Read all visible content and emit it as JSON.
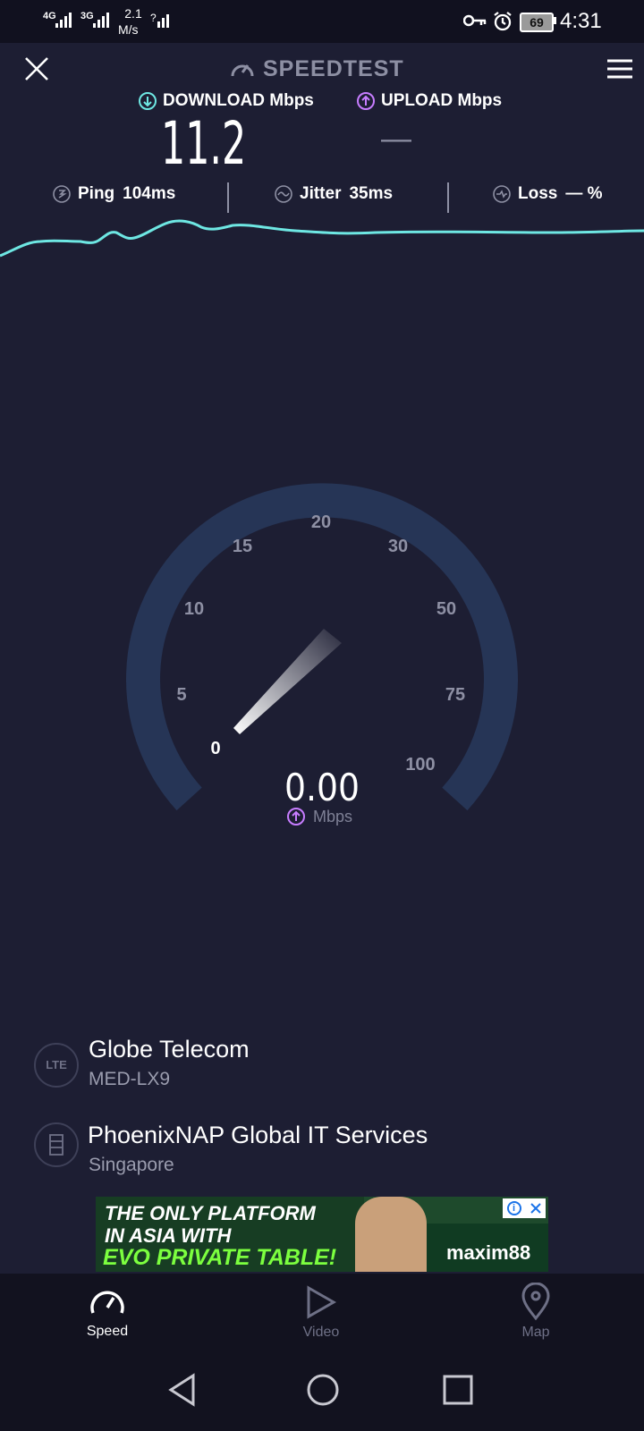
{
  "status_bar": {
    "net1": "4G",
    "net2": "3G",
    "speed_value": "2.1",
    "speed_unit": "M/s",
    "battery": "69",
    "time": "4:31"
  },
  "header": {
    "title": "SPEEDTEST",
    "download_label": "DOWNLOAD Mbps",
    "upload_label": "UPLOAD Mbps",
    "download_value": "11.2",
    "upload_value": "—"
  },
  "metrics": {
    "ping_label": "Ping",
    "ping_value": "104ms",
    "jitter_label": "Jitter",
    "jitter_value": "35ms",
    "loss_label": "Loss",
    "loss_value": "— %"
  },
  "gauge": {
    "ticks": [
      "0",
      "5",
      "10",
      "15",
      "20",
      "30",
      "50",
      "75",
      "100"
    ],
    "reading": "0.00",
    "unit": "Mbps"
  },
  "connection": {
    "provider_badge": "LTE",
    "provider_name": "Globe Telecom",
    "device": "MED-LX9",
    "server_name": "PhoenixNAP Global IT Services",
    "server_location": "Singapore"
  },
  "ad": {
    "line1": "THE ONLY PLATFORM",
    "line2": "IN ASIA WITH",
    "line3": "EVO PRIVATE TABLE!",
    "brand": "maxim88"
  },
  "tabs": [
    {
      "label": "Speed",
      "active": true
    },
    {
      "label": "Video",
      "active": false
    },
    {
      "label": "Map",
      "active": false
    }
  ],
  "colors": {
    "background": "#1d1e33",
    "accent_download": "#6ee7e3",
    "accent_upload": "#c77dff",
    "gauge_track": "#263556"
  }
}
